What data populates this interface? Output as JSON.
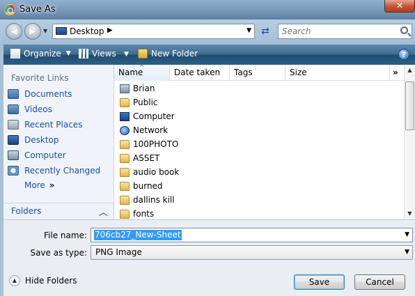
{
  "window": {
    "title": "Save As"
  },
  "address": {
    "location": "Desktop"
  },
  "search": {
    "placeholder": "Search"
  },
  "toolbar": {
    "organize": "Organize",
    "views": "Views",
    "new_folder": "New Folder"
  },
  "favorites": {
    "title": "Favorite Links",
    "items": [
      "Documents",
      "Videos",
      "Recent Places",
      "Desktop",
      "Computer",
      "Recently Changed"
    ],
    "more": "More",
    "folders": "Folders"
  },
  "columns": {
    "name": "Name",
    "date": "Date taken",
    "tags": "Tags",
    "size": "Size"
  },
  "files": [
    "Brian",
    "Public",
    "Computer",
    "Network",
    "100PHOTO",
    "ASSET",
    "audio book",
    "burned",
    "dallins kill",
    "fonts"
  ],
  "form": {
    "file_name_label": "File name:",
    "file_name_value": "706cb27_New-Sheet",
    "save_type_label": "Save as type:",
    "save_type_value": "PNG Image"
  },
  "buttons": {
    "hide_folders": "Hide Folders",
    "save": "Save",
    "cancel": "Cancel"
  }
}
